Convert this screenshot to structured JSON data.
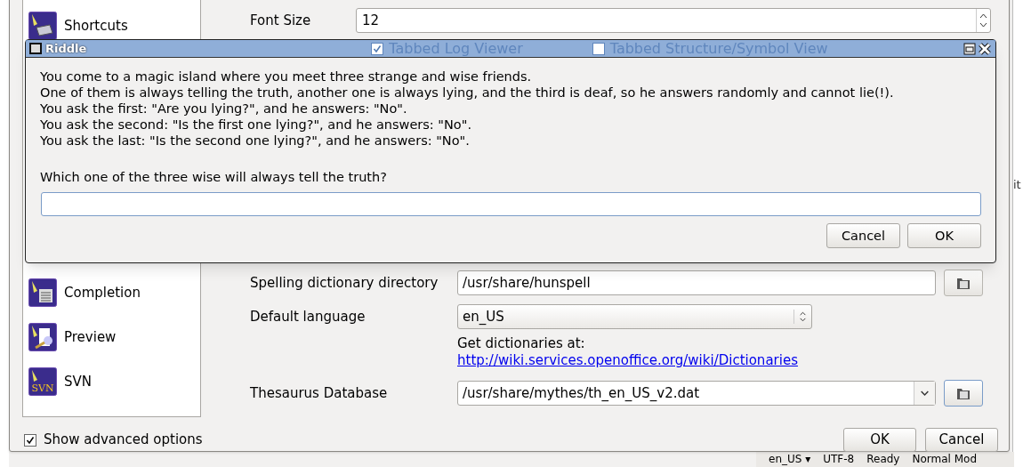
{
  "background_window": {
    "text_fragment": "it",
    "status_bar": [
      "en_US ▾",
      "UTF-8",
      "Ready",
      "Normal Mod"
    ]
  },
  "sidebar": {
    "items": [
      {
        "label": "Shortcuts",
        "kind": "shortcuts"
      },
      {
        "label": "Completion",
        "kind": "completion"
      },
      {
        "label": "Preview",
        "kind": "preview"
      },
      {
        "label": "SVN",
        "kind": "svn",
        "icon_text": "SVN"
      }
    ]
  },
  "show_advanced": {
    "label": "Show advanced options",
    "checked": true
  },
  "settings": {
    "font_size": {
      "label": "Font Size",
      "value": "12"
    },
    "checkboxes": [
      {
        "label": "Tabbed Log Viewer",
        "checked": true
      },
      {
        "label": "Tabbed Structure/Symbol View",
        "checked": false
      }
    ],
    "spelling_dir": {
      "label": "Spelling dictionary directory",
      "value": "/usr/share/hunspell"
    },
    "default_language": {
      "label": "Default language",
      "value": "en_US"
    },
    "dictionaries_hint": "Get dictionaries at:",
    "dictionaries_link": "http://wiki.services.openoffice.org/wiki/Dictionaries",
    "thesaurus": {
      "label": "Thesaurus Database",
      "value": "/usr/share/mythes/th_en_US_v2.dat"
    }
  },
  "buttons": [
    "OK",
    "Cancel"
  ],
  "riddle": {
    "title": "Riddle",
    "lines": [
      "You come to a magic island where you meet three strange and wise friends.",
      "One of them is always telling the truth, another one is always lying, and the third is deaf, so he answers randomly and cannot lie(!).",
      "You ask the first: \"Are you lying?\", and he answers: \"No\".",
      "You ask the second: \"Is the first one lying?\", and he answers: \"No\".",
      "You ask the last: \"Is the second one lying?\", and he answers: \"No\"."
    ],
    "question": "Which one of the three wise will always tell the truth?",
    "buttons": [
      "Cancel",
      "OK"
    ]
  }
}
